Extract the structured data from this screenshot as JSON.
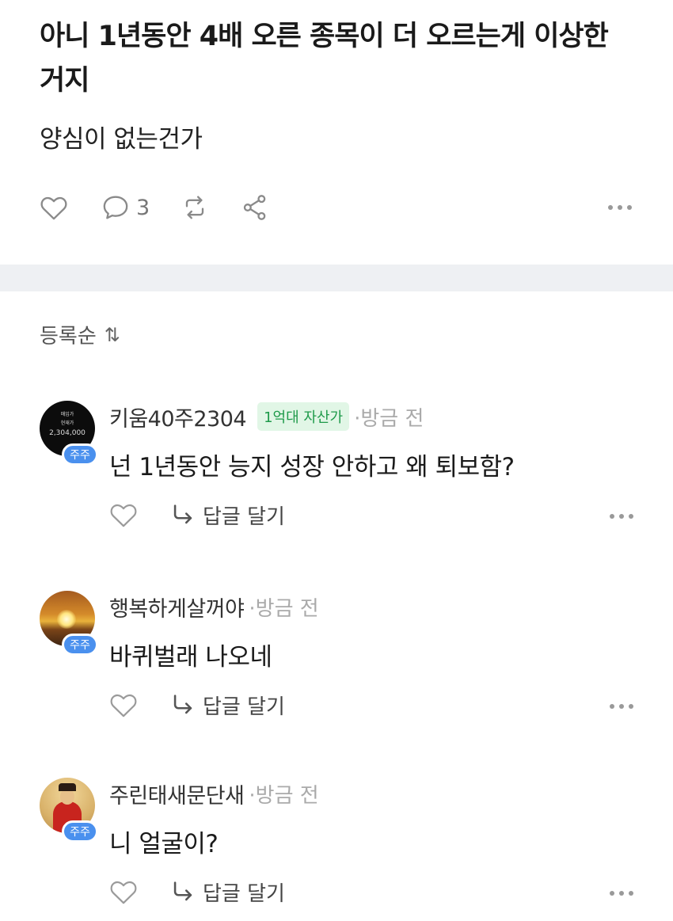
{
  "post": {
    "title": "아니 1년동안 4배 오른 종목이 더 오르는게 이상한거지",
    "body": "양심이 없는건가",
    "comment_count": "3",
    "icons": [
      "heart-icon",
      "comment-icon",
      "repost-icon",
      "share-icon",
      "more-icon"
    ]
  },
  "sort": {
    "label": "등록순",
    "icon": "⇅"
  },
  "comments": [
    {
      "author": "키움40주2304",
      "tag": "1억대 자산가",
      "time": "·방금 전",
      "badge": "주주",
      "text": "넌 1년동안 능지 성장 안하고 왜 퇴보함?",
      "reply_label": "답글 달기",
      "avatar_lines": [
        "매입가",
        "현재가",
        "2,304,000"
      ]
    },
    {
      "author": "행복하게살꺼야",
      "time": "·방금 전",
      "badge": "주주",
      "text": "바퀴벌래 나오네",
      "reply_label": "답글 달기"
    },
    {
      "author": "주린태새문단새",
      "time": "·방금 전",
      "badge": "주주",
      "text": "니 얼굴이?",
      "reply_label": "답글 달기"
    }
  ],
  "colors": {
    "badge_blue": "#4a90ee",
    "tag_bg": "#e1f6e6",
    "tag_text": "#1e9a4a",
    "divider": "#eef0f3"
  }
}
